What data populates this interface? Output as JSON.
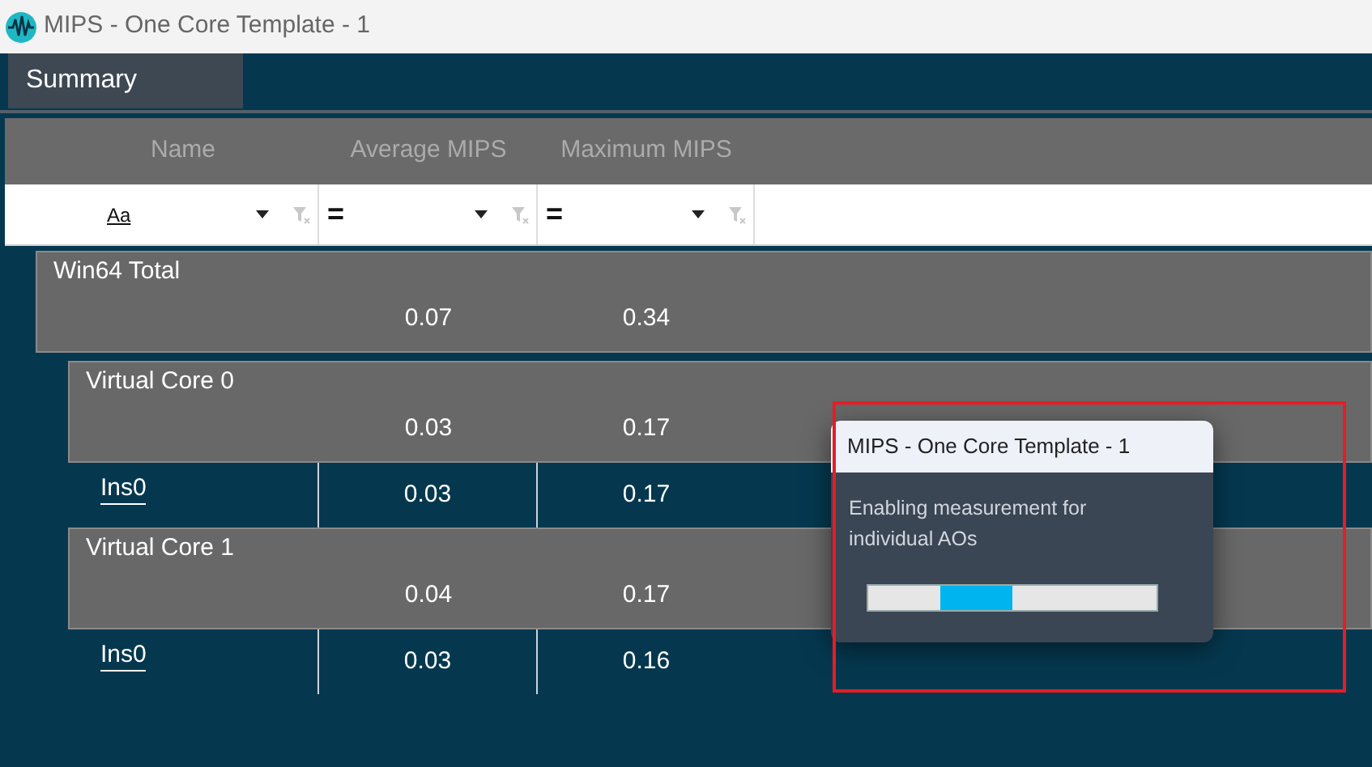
{
  "window": {
    "title": "MIPS - One Core Template - 1"
  },
  "tabs": [
    {
      "label": "Summary",
      "selected": true
    }
  ],
  "table": {
    "columns": [
      "Name",
      "Average MIPS",
      "Maximum MIPS"
    ],
    "filters": [
      {
        "operator": "Aa"
      },
      {
        "operator": "="
      },
      {
        "operator": "="
      }
    ],
    "groups": [
      {
        "name": "Win64 Total",
        "average": "0.07",
        "maximum": "0.34",
        "children": [
          {
            "name": "Virtual Core 0",
            "average": "0.03",
            "maximum": "0.17",
            "children": [
              {
                "name": "Ins0",
                "average": "0.03",
                "maximum": "0.17"
              }
            ]
          },
          {
            "name": "Virtual Core 1",
            "average": "0.04",
            "maximum": "0.17",
            "children": [
              {
                "name": "Ins0",
                "average": "0.03",
                "maximum": "0.16"
              }
            ]
          }
        ]
      }
    ]
  },
  "dialog": {
    "title": "MIPS - One Core Template - 1",
    "message": "Enabling measurement for individual AOs",
    "progress": {
      "level": 0.5
    }
  }
}
